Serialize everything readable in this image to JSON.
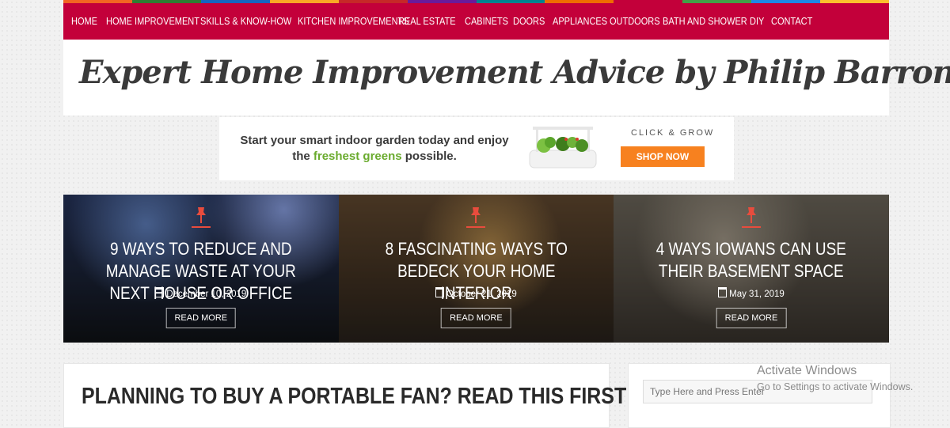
{
  "nav": {
    "stripe_colors": [
      "#f26522",
      "#2e7d32",
      "#1565c0",
      "#f9a825",
      "#c62828",
      "#6a1b9a",
      "#00838f",
      "#ef6c00",
      "#c3003a",
      "#43a047",
      "#1e88e5",
      "#fbc02d"
    ],
    "items": [
      "HOME",
      "HOME IMPROVEMENT",
      "SKILLS & KNOW-HOW",
      "KITCHEN IMPROVEMENTS",
      "REAL ESTATE",
      "CABINETS",
      "DOORS",
      "APPLIANCES",
      "OUTDOORS",
      "BATH AND SHOWER",
      "DIY",
      "CONTACT"
    ]
  },
  "header": {
    "site_title": "Expert Home Improvement Advice by Philip Barron"
  },
  "banner": {
    "line1": "Start your smart indoor garden today and enjoy",
    "line2_before": "the ",
    "line2_green": "freshest greens",
    "line2_after": " possible.",
    "brand": "CLICK & GROW",
    "cta": "SHOP NOW"
  },
  "slides": [
    {
      "title": "9 WAYS TO REDUCE AND MANAGE WASTE AT YOUR NEXT HOUSE OR OFFICE",
      "date": "December 10, 2019",
      "cta": "READ MORE"
    },
    {
      "title": "8 FASCINATING WAYS TO BEDECK YOUR HOME INTERIOR",
      "date": "October 21, 2019",
      "cta": "READ MORE"
    },
    {
      "title": "4 WAYS IOWANS CAN USE THEIR BASEMENT SPACE",
      "date": "May 31, 2019",
      "cta": "READ MORE"
    }
  ],
  "post": {
    "title": "PLANNING TO BUY A PORTABLE FAN? READ THIS FIRST!"
  },
  "sidebar": {
    "search_placeholder": "Type Here and Press Enter"
  },
  "windows_notice": {
    "line1": "Activate Windows",
    "line2": "Go to Settings to activate Windows."
  }
}
